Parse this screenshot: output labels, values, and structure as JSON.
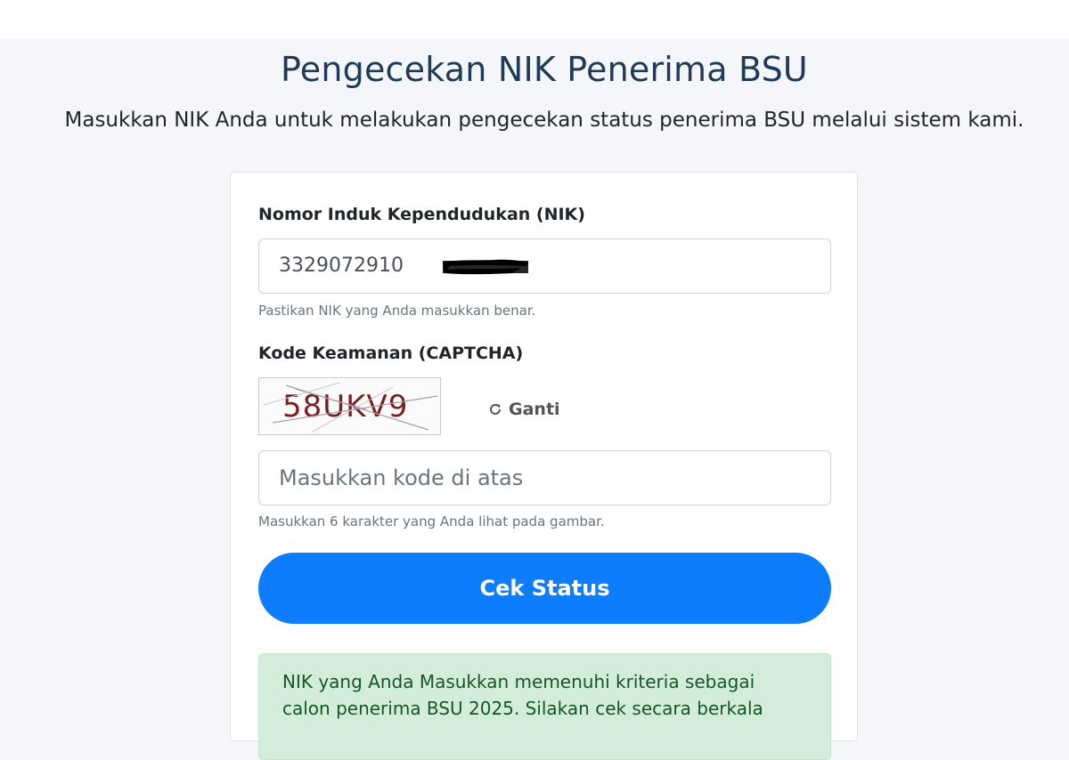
{
  "page": {
    "title": "Pengecekan NIK Penerima BSU",
    "subtitle": "Masukkan NIK Anda untuk melakukan pengecekan status penerima BSU melalui sistem kami."
  },
  "form": {
    "nik_label": "Nomor Induk Kependudukan (NIK)",
    "nik_value": "3329072910",
    "nik_help": "Pastikan NIK yang Anda masukkan benar.",
    "captcha_label": "Kode Keamanan (CAPTCHA)",
    "captcha_code": "58UKV9",
    "refresh_label": "Ganti",
    "code_placeholder": "Masukkan kode di atas",
    "code_help": "Masukkan 6 karakter yang Anda lihat pada gambar.",
    "submit_label": "Cek Status"
  },
  "alert": {
    "message": "NIK yang Anda Masukkan memenuhi kriteria sebagai calon penerima BSU 2025. Silakan cek secara berkala"
  },
  "colors": {
    "primary_button": "#0d7dfd",
    "title": "#1f3b57",
    "alert_bg": "#d4edda",
    "alert_text": "#155724"
  },
  "icons": {
    "refresh": "refresh-icon"
  }
}
